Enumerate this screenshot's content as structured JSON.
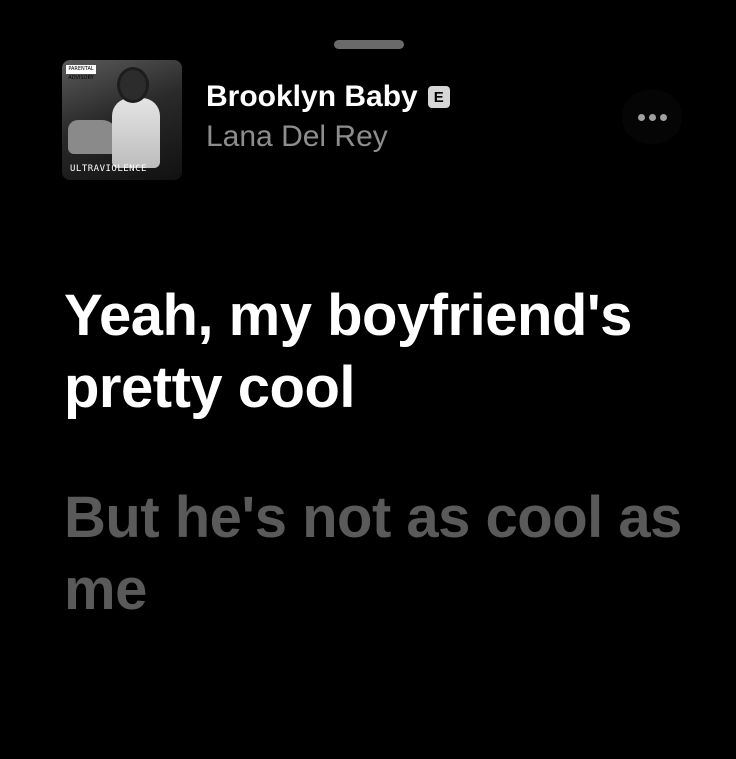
{
  "track": {
    "title": "Brooklyn Baby",
    "explicit_badge": "E",
    "artist": "Lana Del Rey",
    "album_art_label": "ULTRAVIOLENCE",
    "album_art_advisory": "PARENTAL ADVISORY"
  },
  "lyrics": {
    "current_line": "Yeah, my boyfriend's pretty cool",
    "next_line": "But he's not as cool as me"
  },
  "icons": {
    "more": "ellipsis-icon",
    "grabber": "sheet-grabber"
  },
  "colors": {
    "background": "#000000",
    "current_lyric": "#ffffff",
    "upcoming_lyric": "#5a5a5a",
    "artist_text": "#8d8d8d"
  }
}
